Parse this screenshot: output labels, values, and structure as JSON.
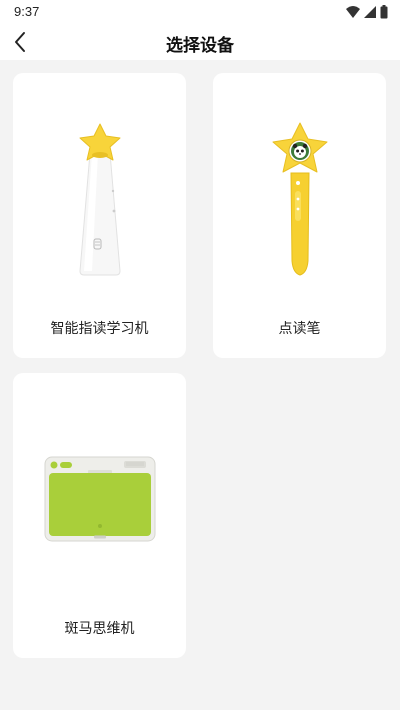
{
  "status_bar": {
    "time": "9:37",
    "icons": [
      "wifi-icon",
      "cellular-signal-icon",
      "battery-icon"
    ]
  },
  "header": {
    "title": "选择设备",
    "back_icon": "chevron-left-icon"
  },
  "devices": [
    {
      "label": "智能指读学习机",
      "image": "smart-reading-machine-image"
    },
    {
      "label": "点读笔",
      "image": "reading-pen-image"
    },
    {
      "label": "斑马思维机",
      "image": "zebra-thinking-machine-image"
    }
  ],
  "colors": {
    "background": "#f3f3f3",
    "card": "#ffffff",
    "star_yellow": "#f8d43a",
    "pen_yellow": "#f6d030",
    "tablet_green": "#a9cf3a"
  }
}
